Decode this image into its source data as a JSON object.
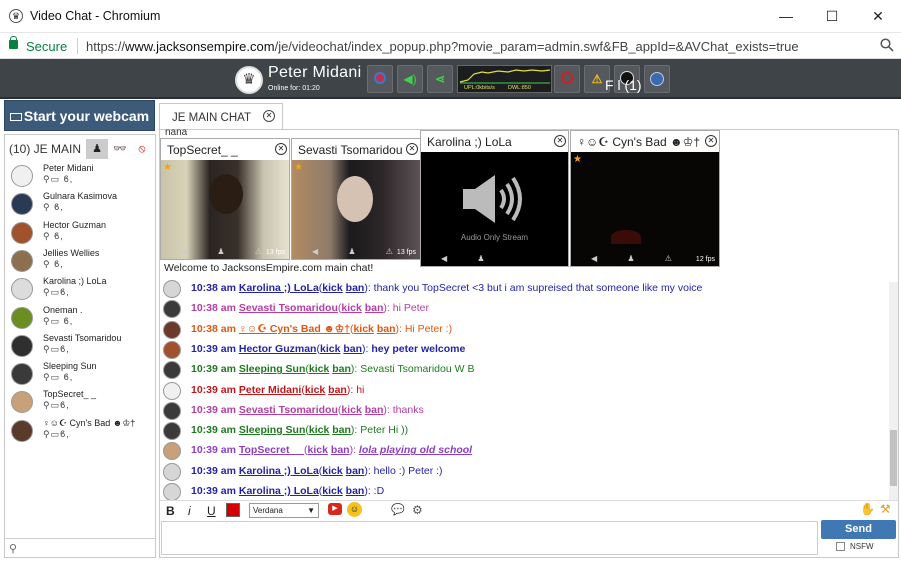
{
  "window": {
    "title": "Video Chat - Chromium",
    "minimize": "—",
    "maximize": "☐",
    "close": "✕"
  },
  "address": {
    "secure_label": "Secure",
    "url_scheme": "https://",
    "url_host": "www.jacksonsempire.com",
    "url_path": "/je/videochat/index_popup.php?movie_param=admin.swf&FB_appId=&AVChat_exists=true"
  },
  "topbar": {
    "user_name": "Peter  Midani",
    "online_for": "Online for: 01:20",
    "graph_up": "UPL:0kbits/s",
    "graph_down": "DWL:850",
    "extra_text": "F           l  (1)"
  },
  "left": {
    "webcam_button": "Start your webcam",
    "room_header": "(10) JE MAIN",
    "users": [
      {
        "name": "Peter  Midani",
        "icons": "⚲▭ ϐ,",
        "color": "#f0f0f0"
      },
      {
        "name": "Gulnara Kasimova",
        "icons": "⚲   ϐ,",
        "color": "#2a3a55"
      },
      {
        "name": "Hector Guzman",
        "icons": "⚲   ϐ,",
        "color": "#a0522d"
      },
      {
        "name": "Jellies Wellies",
        "icons": "⚲   ϐ,",
        "color": "#8b6f4e"
      },
      {
        "name": "Karolina ;) LoLa",
        "icons": "⚲▭ϐ,",
        "color": "#dcdcdc"
      },
      {
        "name": "Oneman  .",
        "icons": "⚲▭ ϐ,",
        "color": "#6b8e23"
      },
      {
        "name": "Sevasti  Tsomaridou",
        "icons": "⚲▭ϐ,",
        "color": "#2f2f2f"
      },
      {
        "name": "Sleeping Sun",
        "icons": "⚲▭ ϐ,",
        "color": "#3a3a3a"
      },
      {
        "name": "TopSecret_ _",
        "icons": "⚲▭ϐ,",
        "color": "#c8a07a"
      },
      {
        "name": "♀☺☪  Cyn's  Bad ☻♔†",
        "icons": "⚲▭ϐ,",
        "color": "#5a3a2a"
      }
    ]
  },
  "chat": {
    "tab_label": "JE MAIN CHAT",
    "nana": "nana",
    "welcome": "Welcome to JacksonsEmpire.com main chat!",
    "videos": [
      {
        "title": "TopSecret_ _",
        "fps": "13 fps"
      },
      {
        "title": "Sevasti  Tsomaridou",
        "fps": "13 fps"
      },
      {
        "title": "Karolina ;) LoLa",
        "audio_only": "Audio Only Stream"
      },
      {
        "title": "♀☺☪  Cyn's  Bad ☻♔†",
        "fps": "12 fps"
      }
    ],
    "kick": "kick",
    "ban": "ban",
    "messages": [
      {
        "time": "10:38 am",
        "name": "Karolina ;) LoLa",
        "text": "thank you TopSecret <3 but i am supreised that someone like my voice",
        "color": "#2323a6",
        "bold": false,
        "italic": false,
        "pic": "#d6d6d6"
      },
      {
        "time": "10:38 am",
        "name": "Sevasti  Tsomaridou",
        "text": "hi Peter",
        "color": "#b43ea3",
        "bold": false,
        "italic": false,
        "pic": "#3b3b3b"
      },
      {
        "time": "10:38 am",
        "name": "♀☺☪  Cyn's  Bad ☻♔†",
        "text": "Hi Peter :)",
        "color": "#e0560f",
        "bold": false,
        "italic": false,
        "pic": "#6b3a2a"
      },
      {
        "time": "10:39 am",
        "name": "Hector Guzman",
        "text": "hey peter welcome",
        "color": "#2323a6",
        "bold": true,
        "italic": false,
        "pic": "#a0522d"
      },
      {
        "time": "10:39 am",
        "name": "Sleeping Sun",
        "text": "Sevasti  Tsomaridou  W B",
        "color": "#1f7a1f",
        "bold": false,
        "italic": false,
        "pic": "#3a3a3a"
      },
      {
        "time": "10:39 am",
        "name": "Peter  Midani",
        "text": "hi",
        "color": "#c0171b",
        "bold": false,
        "italic": false,
        "pic": "#f0f0f0"
      },
      {
        "time": "10:39 am",
        "name": "Sevasti  Tsomaridou",
        "text": "thanks",
        "color": "#b43ea3",
        "bold": false,
        "italic": false,
        "pic": "#3b3b3b"
      },
      {
        "time": "10:39 am",
        "name": "Sleeping Sun",
        "text": "Peter Hi ))",
        "color": "#1f7a1f",
        "bold": false,
        "italic": false,
        "pic": "#3a3a3a"
      },
      {
        "time": "10:39 am",
        "name": "TopSecret_ _",
        "text": "lola playing old school",
        "color": "#8d3fc0",
        "bold": true,
        "italic": true,
        "pic": "#c8a07a"
      },
      {
        "time": "10:39 am",
        "name": "Karolina ;) LoLa",
        "text": "hello :) Peter :)",
        "color": "#2323a6",
        "bold": false,
        "italic": false,
        "pic": "#d6d6d6"
      },
      {
        "time": "10:39 am",
        "name": "Karolina ;) LoLa",
        "text": ":D",
        "color": "#2323a6",
        "bold": false,
        "italic": false,
        "pic": "#d6d6d6"
      }
    ]
  },
  "toolbar": {
    "bold": "B",
    "italic": "i",
    "underline": "U",
    "text_color": "#d40000",
    "font": "Verdana",
    "send": "Send",
    "nsfw": "NSFW"
  }
}
